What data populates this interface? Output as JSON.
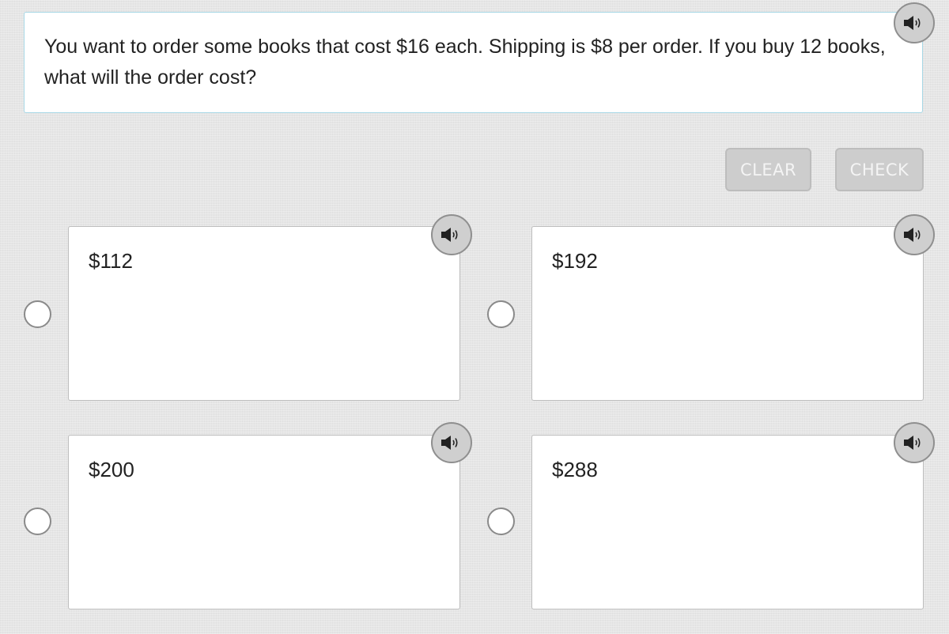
{
  "question": {
    "text": "You want to order some books that cost $16 each. Shipping is $8 per order. If you buy 12 books, what will the order cost?"
  },
  "actions": {
    "clear_label": "CLEAR",
    "check_label": "CHECK",
    "enabled": false
  },
  "choices": [
    {
      "label": "$112",
      "selected": false
    },
    {
      "label": "$192",
      "selected": false
    },
    {
      "label": "$200",
      "selected": false
    },
    {
      "label": "$288",
      "selected": false
    }
  ],
  "icons": {
    "audio": "speaker-icon",
    "choice_select": "radio-button"
  },
  "colors": {
    "question_border": "#a8d8e6",
    "button_disabled_bg": "#cdcdcd",
    "button_disabled_text": "#f4f4f4",
    "audio_button_bg": "#cfcfcf"
  }
}
